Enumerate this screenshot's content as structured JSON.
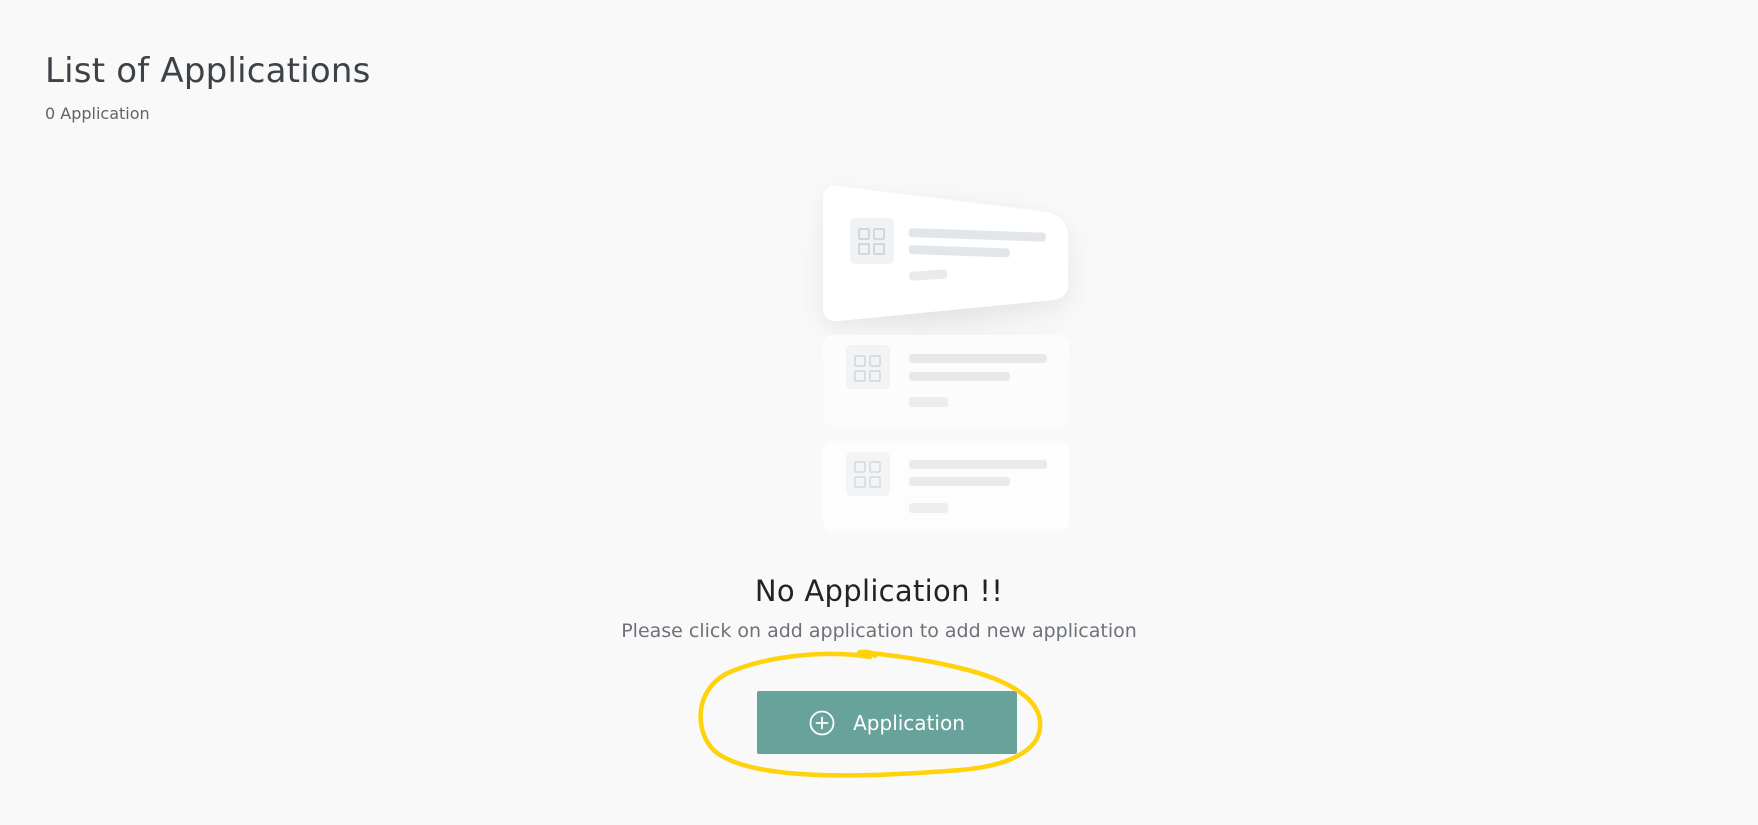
{
  "header": {
    "title": "List of Applications",
    "count": "0 Application"
  },
  "empty_state": {
    "title": "No Application !!",
    "subtitle": "Please click on add application to add new application",
    "illustration_icon": "grid-icon"
  },
  "actions": {
    "add_button_label": "Application",
    "add_button_icon": "plus-circle-icon"
  },
  "colors": {
    "background": "#f9f9f9",
    "primary_button": "#67a39b",
    "annotation_highlight": "#ffd20a"
  }
}
